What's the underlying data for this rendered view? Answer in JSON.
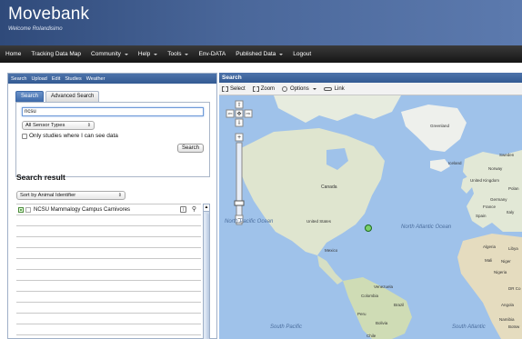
{
  "header": {
    "title": "Movebank",
    "welcome": "Welcome Rolandisimo"
  },
  "nav": {
    "items": [
      {
        "label": "Home",
        "dropdown": false
      },
      {
        "label": "Tracking Data Map",
        "dropdown": false
      },
      {
        "label": "Community",
        "dropdown": true
      },
      {
        "label": "Help",
        "dropdown": true
      },
      {
        "label": "Tools",
        "dropdown": true
      },
      {
        "label": "Env-DATA",
        "dropdown": false
      },
      {
        "label": "Published Data",
        "dropdown": true
      },
      {
        "label": "Logout",
        "dropdown": false
      }
    ]
  },
  "left_toolbar": [
    "Search",
    "Upload",
    "Edit",
    "Studies",
    "Weather"
  ],
  "search": {
    "tabs": [
      "Search",
      "Advanced Search"
    ],
    "query": "ncsu",
    "sensor_filter": "All Sensor Types",
    "only_mine_label": "Only studies where I can see data",
    "button_label": "Search"
  },
  "results": {
    "title": "Search result",
    "sort_option": "Sort by Animal Identifier",
    "first_item": "NCSU Mammalogy Campus Carnivores"
  },
  "map": {
    "title": "Search",
    "toolbar": [
      "Select",
      "Zoom",
      "Options",
      "Link"
    ],
    "labels": {
      "greenland": "Greenland",
      "iceland": "Iceland",
      "norway": "Norway",
      "sweden": "Sweden",
      "united_kingdom": "United Kingdom",
      "germany": "Germany",
      "poland": "Polan",
      "france": "France",
      "spain": "Spain",
      "italy": "Italy",
      "canada": "Canada",
      "united_states": "United States",
      "mexico": "Mexico",
      "venezuela": "Venezuela",
      "colombia": "Colombia",
      "peru": "Peru",
      "brazil": "Brazil",
      "bolivia": "Bolivia",
      "chile": "Chile",
      "algeria": "Algeria",
      "libya": "Libya",
      "mali": "Mali",
      "niger": "Niger",
      "nigeria": "Nigeria",
      "dr_congo": "DR Co",
      "angola": "Angola",
      "namibia": "Namibia",
      "botswana": "Botsw",
      "north_pacific": "North Pacific Ocean",
      "north_atlantic": "North Atlantic Ocean",
      "south_pacific": "South Pacific",
      "south_atlantic": "South Atlantic"
    }
  }
}
